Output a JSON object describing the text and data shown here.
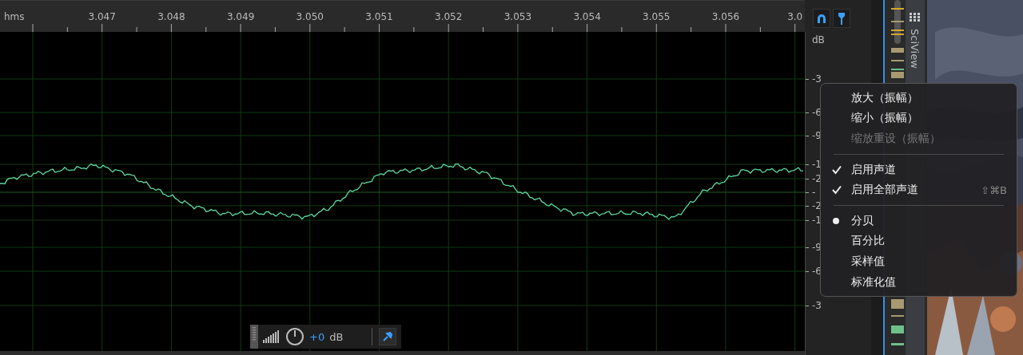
{
  "ruler": {
    "unit": "hms",
    "ticks": [
      "3.047",
      "3.048",
      "3.049",
      "3.050",
      "3.051",
      "3.052",
      "3.053",
      "3.054",
      "3.055",
      "3.056",
      "3.0"
    ]
  },
  "db_axis": {
    "unit": "dB",
    "labels": [
      "-3",
      "-6",
      "-9",
      "-1",
      "-2",
      "-",
      "-2",
      "-1",
      "-9",
      "-6",
      "-3"
    ]
  },
  "gain": {
    "value": "+0",
    "unit": "dB"
  },
  "side_tab": {
    "label": "SciView"
  },
  "context_menu": {
    "sections": [
      [
        {
          "label": "放大（振幅）",
          "kind": "plain",
          "disabled": false
        },
        {
          "label": "缩小（振幅）",
          "kind": "plain",
          "disabled": false
        },
        {
          "label": "缩放重设（振幅）",
          "kind": "plain",
          "disabled": true
        }
      ],
      [
        {
          "label": "启用声道",
          "kind": "check",
          "checked": true,
          "disabled": false
        },
        {
          "label": "启用全部声道",
          "kind": "check",
          "checked": true,
          "disabled": false,
          "shortcut": "⇧⌘B"
        }
      ],
      [
        {
          "label": "分贝",
          "kind": "radio",
          "selected": true,
          "disabled": false
        },
        {
          "label": "百分比",
          "kind": "radio",
          "selected": false,
          "disabled": false
        },
        {
          "label": "采样值",
          "kind": "radio",
          "selected": false,
          "disabled": false
        },
        {
          "label": "标准化值",
          "kind": "radio",
          "selected": false,
          "disabled": false
        }
      ]
    ]
  }
}
